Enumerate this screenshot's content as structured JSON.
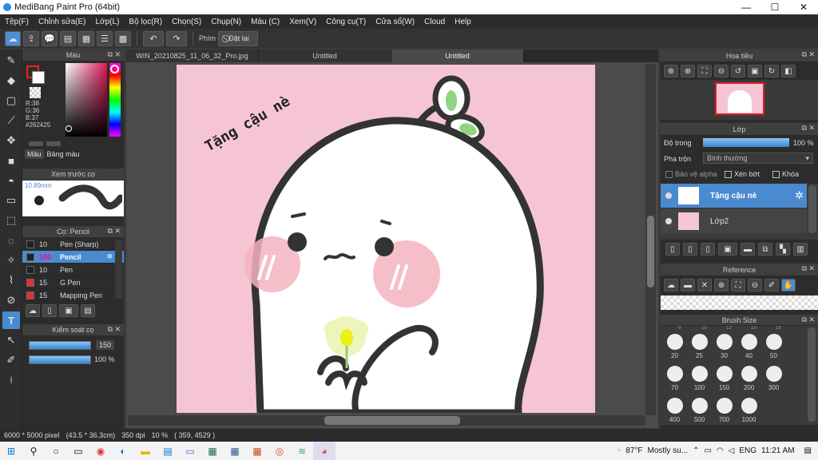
{
  "app": {
    "title": "MediBang Paint Pro (64bit)"
  },
  "window_controls": {
    "minimize": "—",
    "maximize": "☐",
    "close": "✕"
  },
  "menu": [
    "Tệp(F)",
    "Chỉnh sửa(E)",
    "Lớp(L)",
    "Bộ lọc(R)",
    "Chọn(S)",
    "Chụp(N)",
    "Màu (C)",
    "Xem(V)",
    "Công cụ(T)",
    "Cửa sổ(W)",
    "Cloud",
    "Help"
  ],
  "toolbar": {
    "shortcut_label": "Phím",
    "reset_label": "Đặt lại"
  },
  "tabs": [
    {
      "label": "WIN_20210825_11_06_32_Pro.jpg",
      "active": false
    },
    {
      "label": "Untitled",
      "active": false
    },
    {
      "label": "Untitled",
      "active": true
    }
  ],
  "color_panel": {
    "title": "Màu",
    "r": "R:38",
    "g": "G:36",
    "b": "B:37",
    "hex": "#262425",
    "fg_color": "#262425",
    "tab_color": "Màu",
    "tab_palette": "Bảng màu"
  },
  "brush_preview": {
    "title": "Xem trước cọ",
    "size": "10.89mm"
  },
  "brush_panel": {
    "title": "Cọ: Pencil",
    "items": [
      {
        "size": "10",
        "name": "Pen (Sharp)",
        "color": "#222222",
        "selected": false
      },
      {
        "size": "150",
        "name": "Pencil",
        "color": "#222222",
        "selected": true
      },
      {
        "size": "10",
        "name": "Pen",
        "color": "#222222",
        "selected": false
      },
      {
        "size": "15",
        "name": "G Pen",
        "color": "#e03030",
        "selected": false
      },
      {
        "size": "15",
        "name": "Mapping Pen",
        "color": "#e03030",
        "selected": false
      }
    ]
  },
  "brush_control": {
    "title": "Kiểm soát cọ",
    "size_value": "150",
    "opacity_value": "100 %"
  },
  "canvas_text": {
    "caption": "Tặng cậu nè"
  },
  "navigator": {
    "title": "Hoa tiêu"
  },
  "layer_panel": {
    "title": "Lớp",
    "opacity_label": "Độ trong",
    "opacity_value": "100 %",
    "blend_label": "Pha trộn",
    "blend_value": "Bình thường",
    "protect_alpha": "Bảo vệ alpha",
    "clipping": "Xén bớt",
    "lock": "Khóa",
    "layers": [
      {
        "name": "Tặng cậu nè",
        "selected": true
      },
      {
        "name": "Lớp2",
        "selected": false
      }
    ]
  },
  "reference_panel": {
    "title": "Reference"
  },
  "brush_size_panel": {
    "title": "Brush Size",
    "top_row": [
      "9",
      "10",
      "12",
      "15",
      "18"
    ],
    "sizes": [
      "20",
      "25",
      "30",
      "40",
      "50",
      "70",
      "100",
      "150",
      "200",
      "300",
      "400",
      "500",
      "700",
      "1000"
    ]
  },
  "status": {
    "size": "6000 * 5000 pixel",
    "physical": "(43.5 * 36.3cm)",
    "dpi": "350 dpi",
    "zoom": "10 %",
    "coords": "( 359, 4529 )"
  },
  "taskbar": {
    "weather": "87°F",
    "weather_text": "Mostly su...",
    "lang": "ENG",
    "time": "11:21 AM"
  }
}
